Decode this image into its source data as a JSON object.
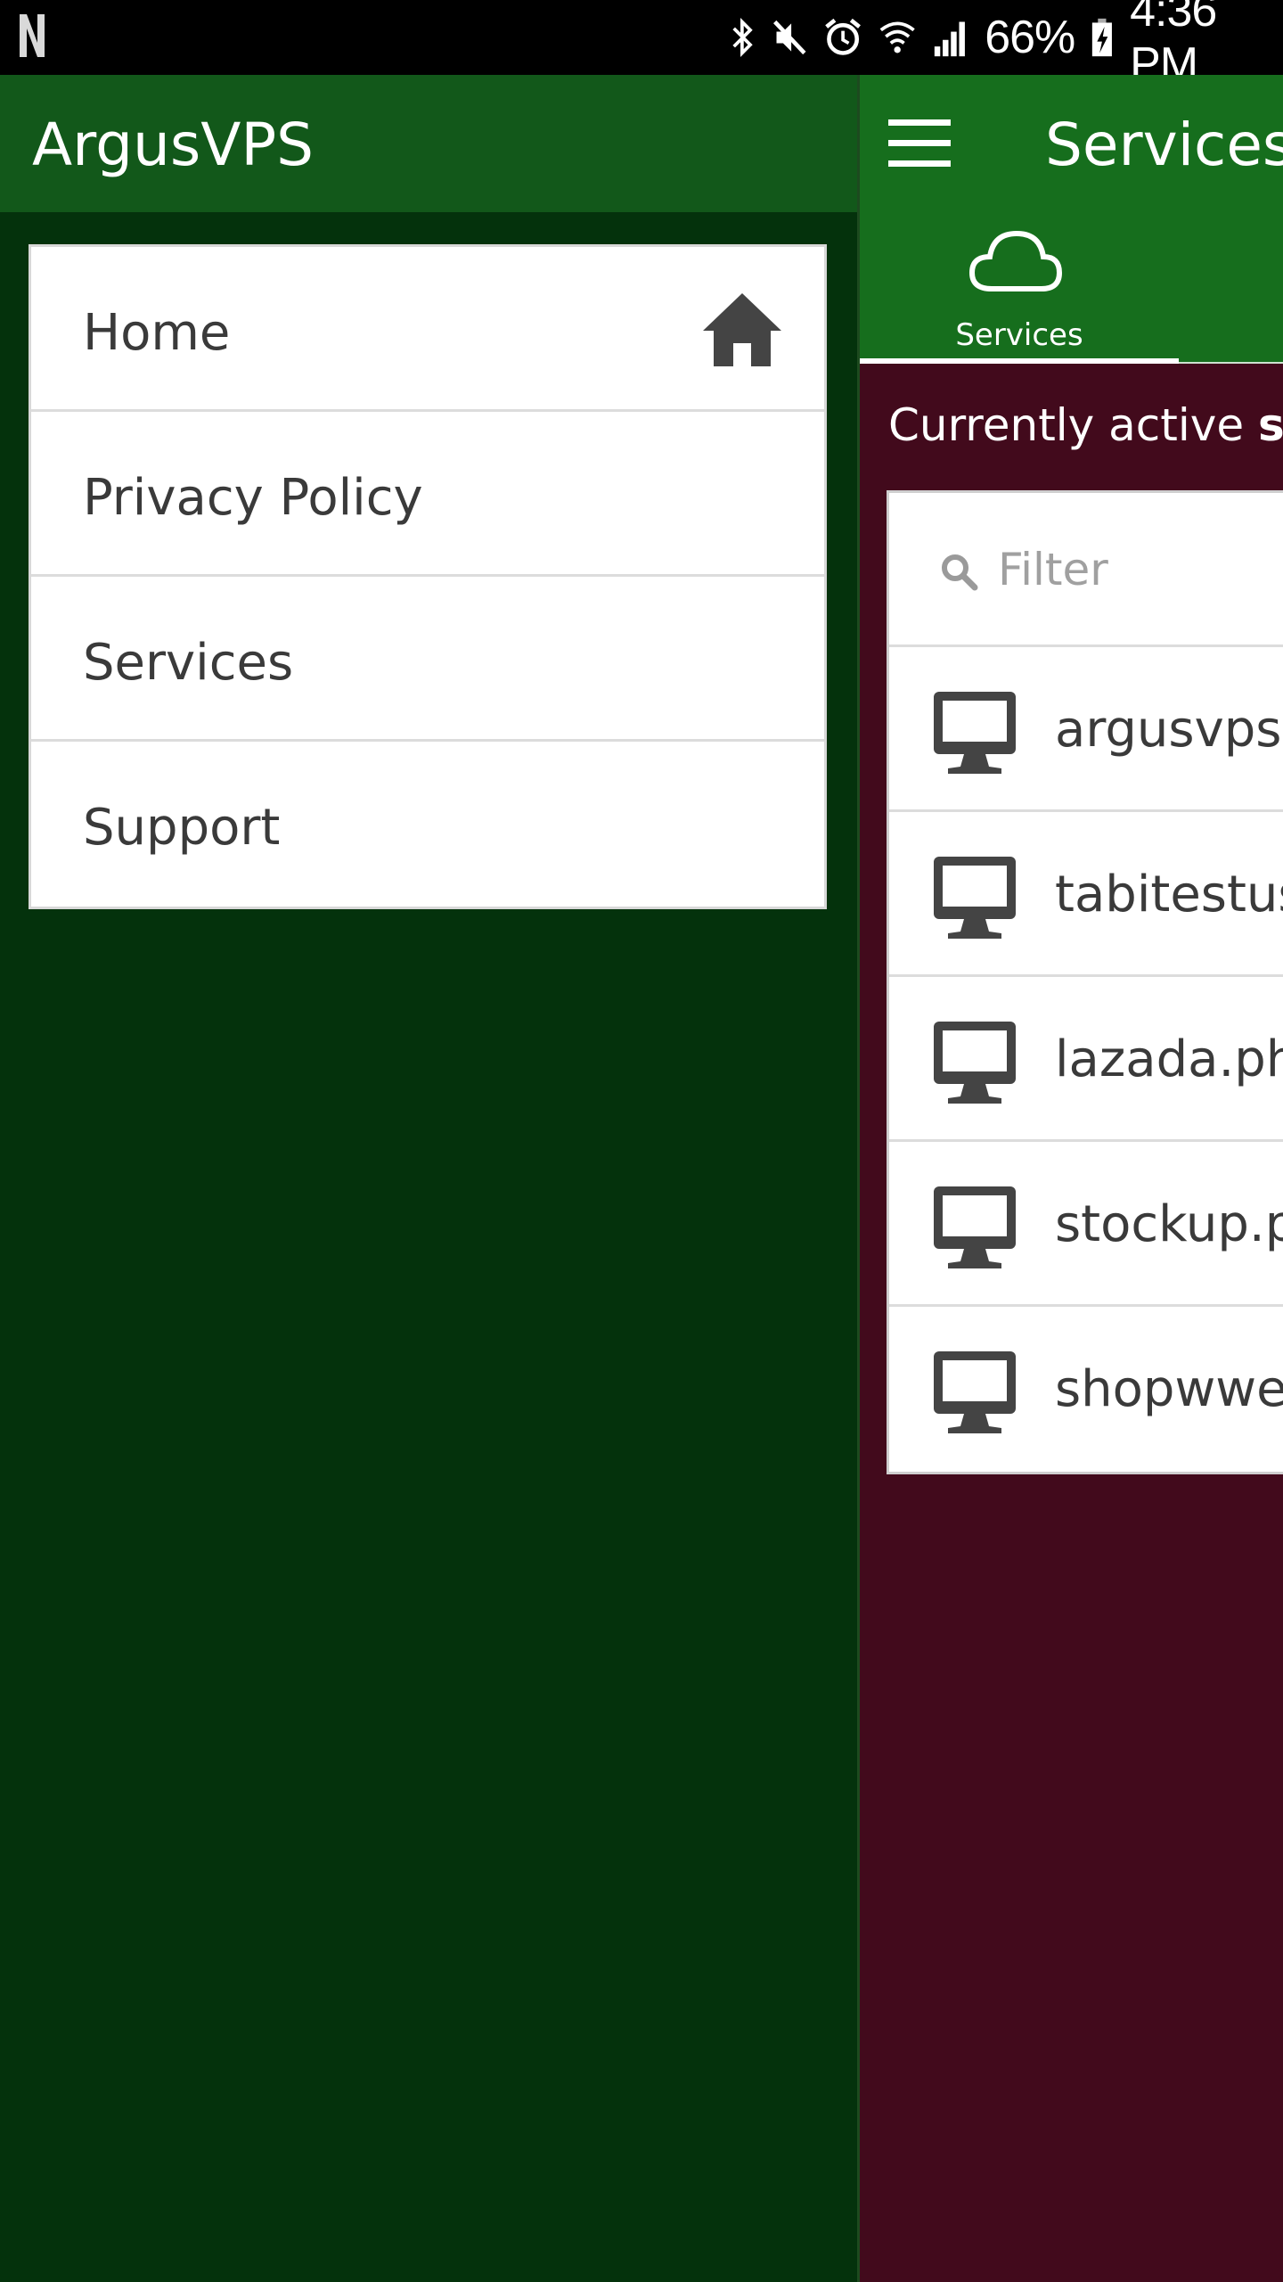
{
  "status_bar": {
    "battery": "66%",
    "time": "4:36 PM"
  },
  "drawer": {
    "title": "ArgusVPS",
    "items": [
      {
        "label": "Home",
        "icon": "home-icon"
      },
      {
        "label": "Privacy Policy"
      },
      {
        "label": "Services"
      },
      {
        "label": "Support"
      }
    ]
  },
  "topbar": {
    "title": "Services"
  },
  "tabs": [
    {
      "label": "Services",
      "icon": "cloud-icon",
      "selected": true
    }
  ],
  "content": {
    "active_prefix": "Currently active ",
    "active_bold": "ser",
    "filter_placeholder": "Filter",
    "services": [
      {
        "name": "argusvps."
      },
      {
        "name": "tabitestus"
      },
      {
        "name": "lazada.ph"
      },
      {
        "name": "stockup.p"
      },
      {
        "name": "shopwwel"
      }
    ]
  },
  "colors": {
    "drawer_header": "#12581a",
    "drawer_body": "#04320c",
    "topbar": "#166e1d",
    "content_bg": "#420a1c"
  }
}
